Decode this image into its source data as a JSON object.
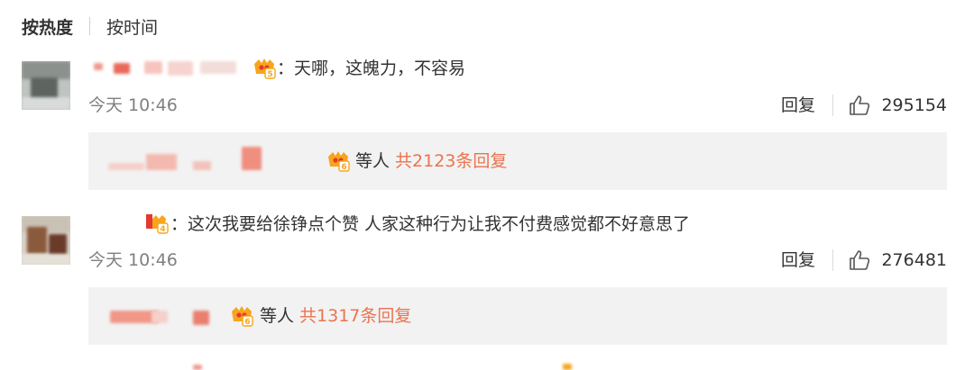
{
  "tabs": {
    "hot": "按热度",
    "time": "按时间"
  },
  "comments": [
    {
      "text": "：天哪，这魄力，不容易",
      "time": "今天 10:46",
      "reply_label": "回复",
      "likes": "295154",
      "vip_icon": "crown-vip-badge-icon",
      "reply_summary": {
        "others": "等人",
        "total": "共2123条回复"
      }
    },
    {
      "text": "：这次我要给徐铮点个赞 人家这种行为让我不付费感觉都不好意思了",
      "time": "今天 10:46",
      "reply_label": "回复",
      "likes": "276481",
      "vip_icon": "crown-vip-badge-icon",
      "reply_summary": {
        "others": "等人",
        "total": "共1317条回复"
      }
    }
  ],
  "colors": {
    "accent_orange": "#eb7350",
    "reply_bg": "#f2f2f2",
    "meta_gray": "#808080"
  }
}
